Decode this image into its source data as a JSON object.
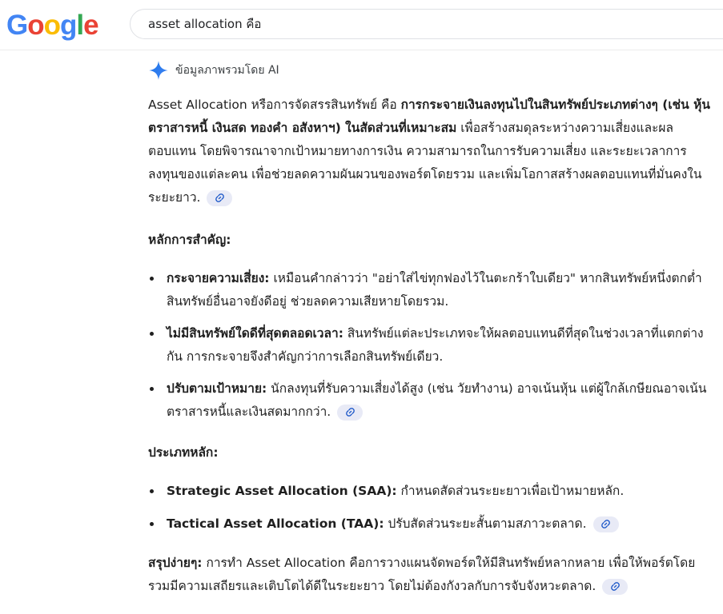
{
  "header": {
    "logo_letters": [
      "G",
      "o",
      "o",
      "g",
      "l",
      "e"
    ],
    "logo_colors": [
      "#4285F4",
      "#EA4335",
      "#FBBC05",
      "#4285F4",
      "#34A853",
      "#EA4335"
    ],
    "search_query": "asset allocation คือ"
  },
  "ai_overview": {
    "label": "ข้อมูลภาพรวมโดย AI",
    "icon": "gemini-spark-icon",
    "intro": {
      "part1": "Asset Allocation หรือการจัดสรรสินทรัพย์ คือ ",
      "bold": "การกระจายเงินลงทุนไปในสินทรัพย์ประเภทต่างๆ (เช่น หุ้น ตราสารหนี้ เงินสด ทองคำ อสังหาฯ) ในสัดส่วนที่เหมาะสม",
      "part2": " เพื่อสร้างสมดุลระหว่างความเสี่ยงและผลตอบแทน โดยพิจารณาจากเป้าหมายทางการเงิน ความสามารถในการรับความเสี่ยง และระยะเวลาการลงทุนของแต่ละคน เพื่อช่วยลดความผันผวนของพอร์ตโดยรวม และเพิ่มโอกาสสร้างผลตอบแทนที่มั่นคงในระยะยาว."
    },
    "principles": {
      "heading": "หลักการสำคัญ:",
      "items": [
        {
          "title": "กระจายความเสี่ยง:",
          "text": " เหมือนคำกล่าวว่า \"อย่าใส่ไข่ทุกฟองไว้ในตะกร้าใบเดียว\" หากสินทรัพย์หนึ่งตกต่ำ สินทรัพย์อื่นอาจยังดีอยู่ ช่วยลดความเสียหายโดยรวม."
        },
        {
          "title": "ไม่มีสินทรัพย์ใดดีที่สุดตลอดเวลา:",
          "text": " สินทรัพย์แต่ละประเภทจะให้ผลตอบแทนดีที่สุดในช่วงเวลาที่แตกต่างกัน การกระจายจึงสำคัญกว่าการเลือกสินทรัพย์เดียว."
        },
        {
          "title": "ปรับตามเป้าหมาย:",
          "text": " นักลงทุนที่รับความเสี่ยงได้สูง (เช่น วัยทำงาน) อาจเน้นหุ้น แต่ผู้ใกล้เกษียณอาจเน้นตราสารหนี้และเงินสดมากกว่า."
        }
      ]
    },
    "types": {
      "heading": "ประเภทหลัก:",
      "items": [
        {
          "title": "Strategic Asset Allocation (SAA):",
          "text": " กำหนดสัดส่วนระยะยาวเพื่อเป้าหมายหลัก."
        },
        {
          "title": "Tactical Asset Allocation (TAA):",
          "text": " ปรับสัดส่วนระยะสั้นตามสภาวะตลาด."
        }
      ]
    },
    "summary": {
      "bold": "สรุปง่ายๆ:",
      "text": " การทำ Asset Allocation คือการวางแผนจัดพอร์ตให้มีสินทรัพย์หลากหลาย เพื่อให้พอร์ตโดยรวมมีความเสถียรและเติบโตได้ดีในระยะยาว โดยไม่ต้องกังวลกับการจับจังหวะตลาด."
    },
    "link_icon": "link-icon"
  }
}
